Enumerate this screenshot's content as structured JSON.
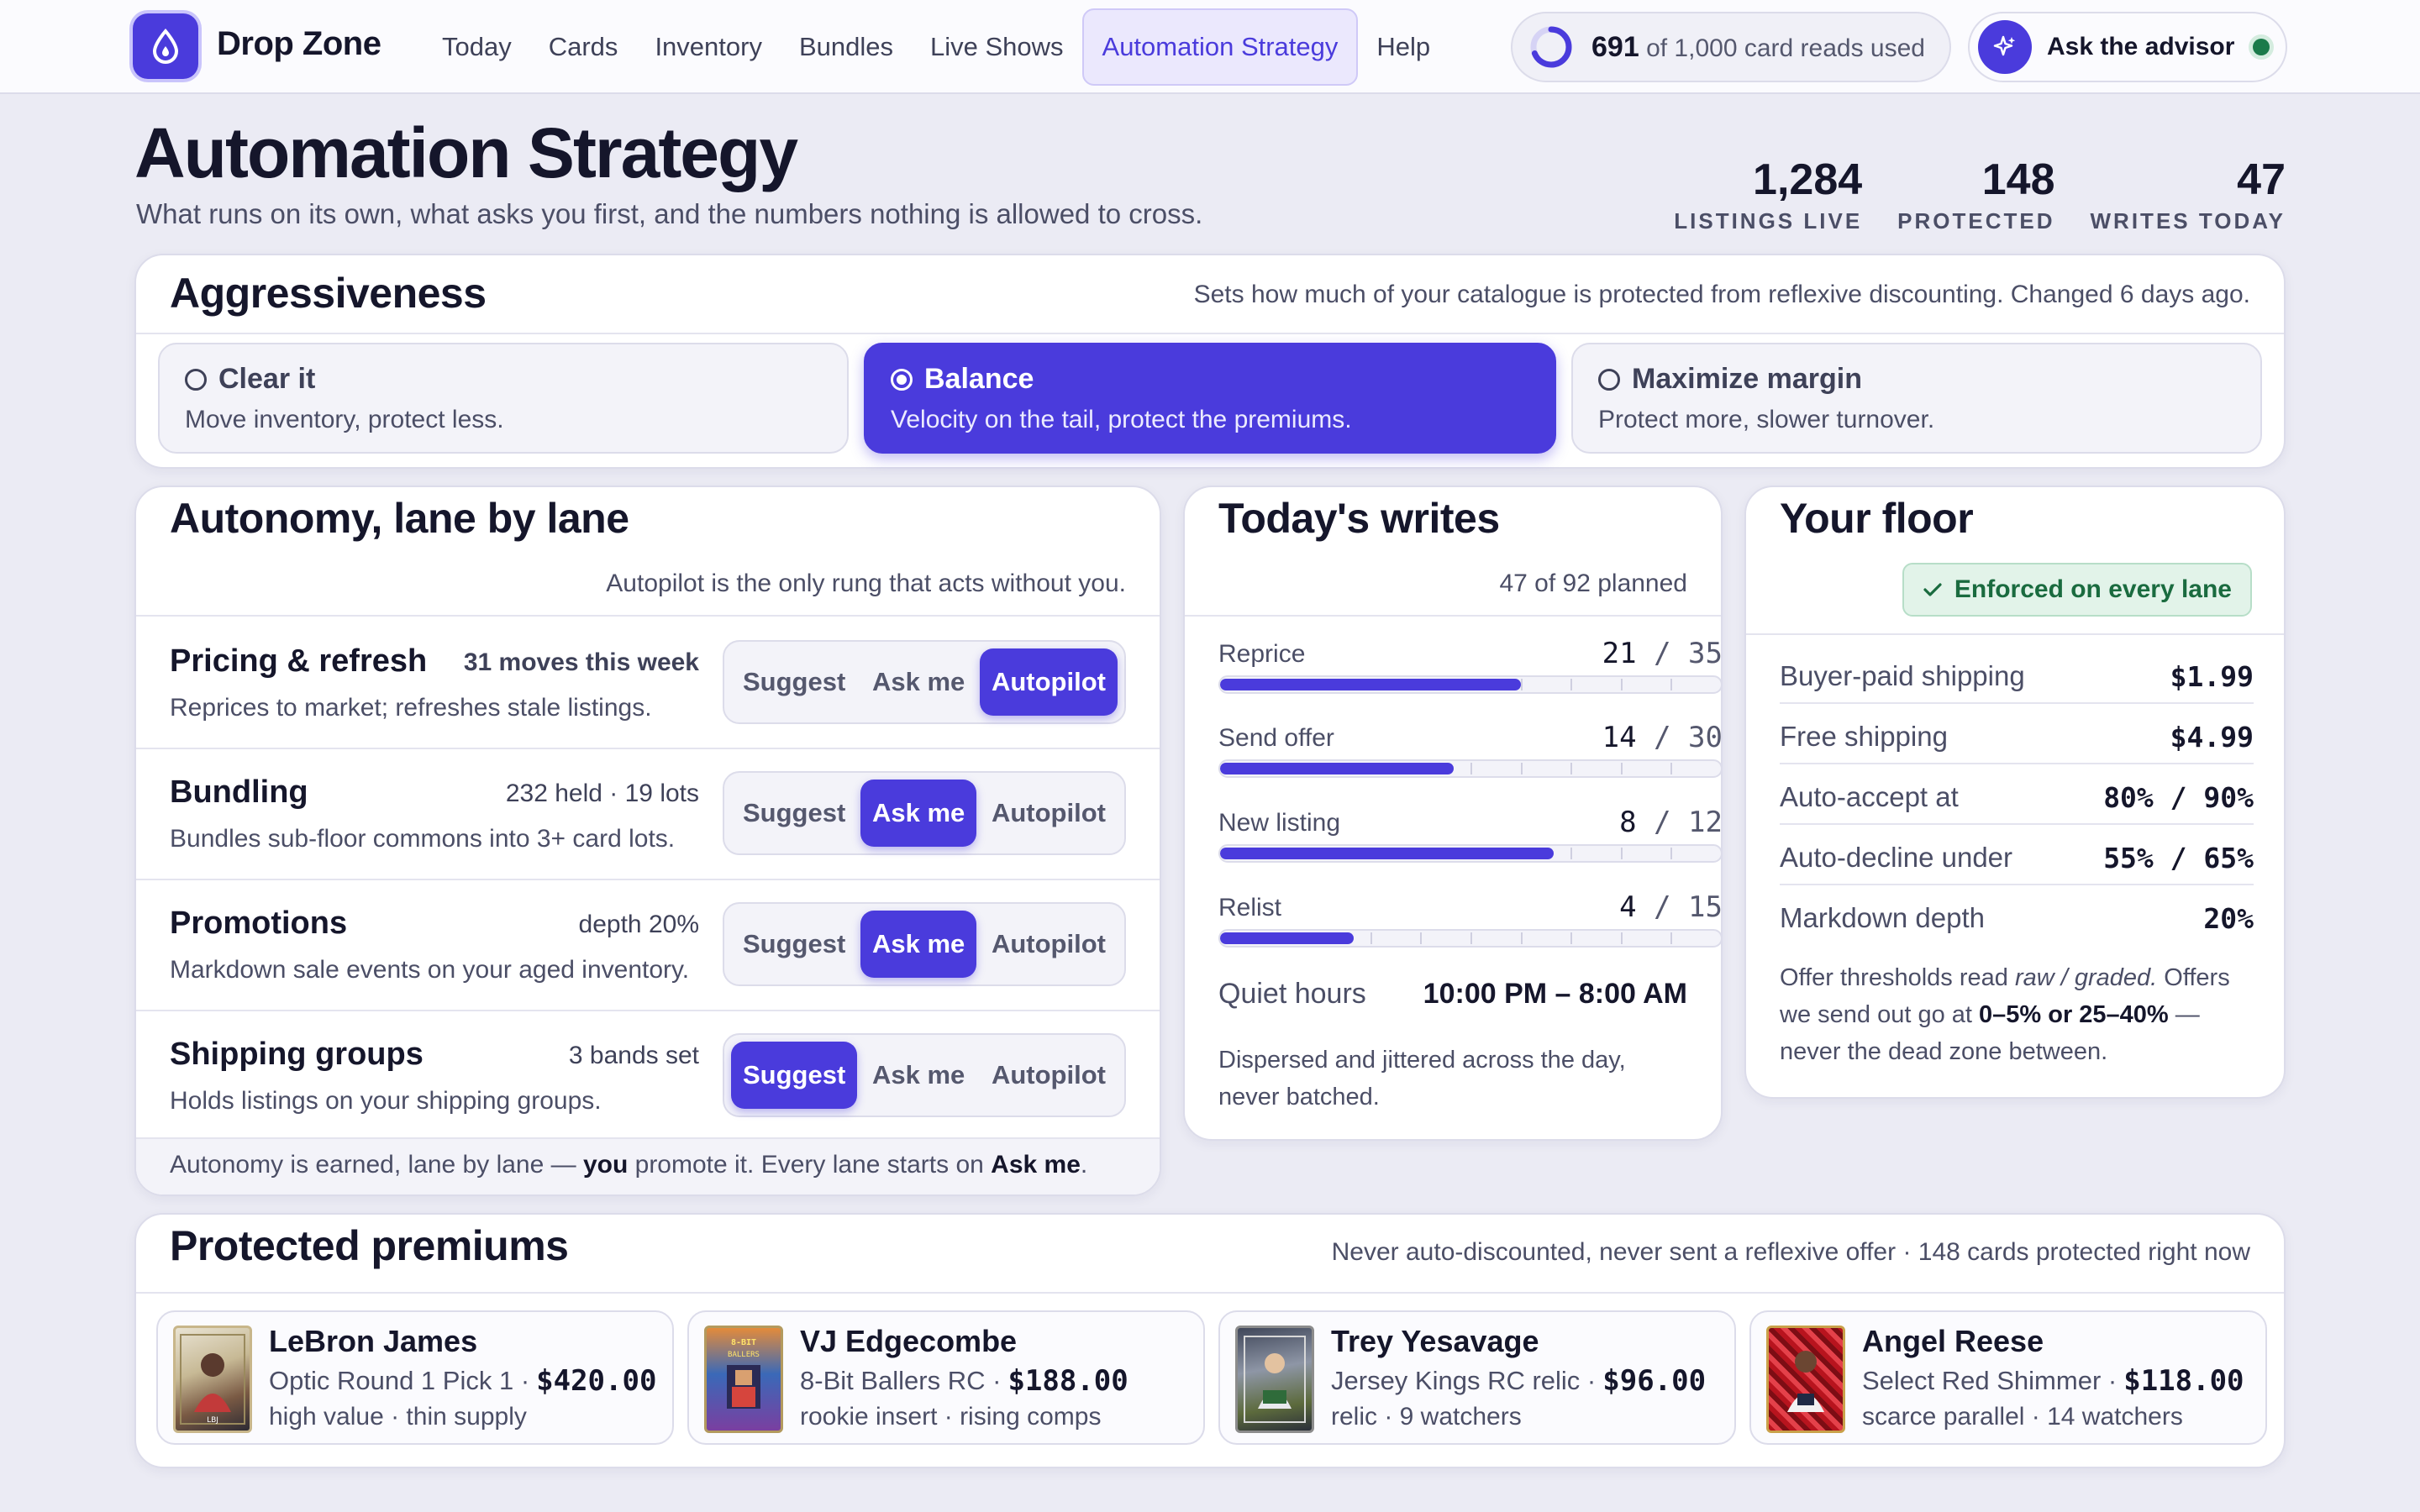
{
  "app": {
    "brand": "Drop Zone",
    "nav": [
      "Today",
      "Cards",
      "Inventory",
      "Bundles",
      "Live Shows",
      "Automation Strategy",
      "Help"
    ],
    "active_nav": "Automation Strategy",
    "usage": {
      "used": "691",
      "rest": "of 1,000 card reads used",
      "fraction": 0.691
    },
    "advisor_label": "Ask the advisor",
    "accent": "#4a3bdc"
  },
  "header": {
    "title": "Automation Strategy",
    "subtitle": "What runs on its own, what asks you first, and the numbers nothing is allowed to cross.",
    "stats": [
      {
        "value": "1,284",
        "label": "LISTINGS LIVE"
      },
      {
        "value": "148",
        "label": "PROTECTED"
      },
      {
        "value": "47",
        "label": "WRITES TODAY"
      }
    ]
  },
  "aggressiveness": {
    "title": "Aggressiveness",
    "note": "Sets how much of your catalogue is protected from reflexive discounting. Changed 6 days ago.",
    "options": [
      {
        "label": "Clear it",
        "desc": "Move inventory, protect less.",
        "selected": false
      },
      {
        "label": "Balance",
        "desc": "Velocity on the tail, protect the premiums.",
        "selected": true
      },
      {
        "label": "Maximize margin",
        "desc": "Protect more, slower turnover.",
        "selected": false
      }
    ]
  },
  "autonomy": {
    "title": "Autonomy, lane by lane",
    "note": "Autopilot is the only rung that acts without you.",
    "modes": [
      "Suggest",
      "Ask me",
      "Autopilot"
    ],
    "lanes": [
      {
        "name": "Pricing & refresh",
        "stat": "31 moves this week",
        "desc": "Reprices to market; refreshes stale listings.",
        "mode": "Autopilot"
      },
      {
        "name": "Bundling",
        "stat": "232 held · 19 lots",
        "desc": "Bundles sub-floor commons into 3+ card lots.",
        "mode": "Ask me"
      },
      {
        "name": "Promotions",
        "stat": "depth 20%",
        "desc": "Markdown sale events on your aged inventory.",
        "mode": "Ask me"
      },
      {
        "name": "Shipping groups",
        "stat": "3 bands set",
        "desc": "Holds listings on your shipping groups.",
        "mode": "Suggest"
      }
    ],
    "footer": {
      "a": "Autonomy is earned, lane by lane — ",
      "b": "you",
      "c": " promote it. Every lane starts on ",
      "d": "Ask me",
      "e": "."
    }
  },
  "writes": {
    "title": "Today's writes",
    "planned": "47 of 92 planned",
    "rows": [
      {
        "label": "Reprice",
        "done": 21,
        "total": 35
      },
      {
        "label": "Send offer",
        "done": 14,
        "total": 30
      },
      {
        "label": "New listing",
        "done": 8,
        "total": 12
      },
      {
        "label": "Relist",
        "done": 4,
        "total": 15
      }
    ],
    "quiet_label": "Quiet hours",
    "quiet_value": "10:00 PM – 8:00 AM",
    "note": "Dispersed and jittered across the day, never batched."
  },
  "floor": {
    "title": "Your floor",
    "badge": "Enforced on every lane",
    "rows": [
      {
        "label": "Buyer-paid shipping",
        "value": "$1.99"
      },
      {
        "label": "Free shipping",
        "value": "$4.99"
      },
      {
        "label": "Auto-accept at",
        "value": "80% / 90%"
      },
      {
        "label": "Auto-decline under",
        "value": "55% / 65%"
      },
      {
        "label": "Markdown depth",
        "value": "20%"
      }
    ],
    "note": {
      "a": "Offer thresholds read ",
      "b": "raw / graded.",
      "c": " Offers we send out go at ",
      "d": "0–5% or 25–40%",
      "e": " — never the dead zone between."
    }
  },
  "premiums": {
    "title": "Protected premiums",
    "note": "Never auto-discounted, never sent a reflexive offer · 148 cards protected right now",
    "cards": [
      {
        "name": "LeBron James",
        "set": "Optic Round 1 Pick 1 ·",
        "price": "$420.00",
        "tags": "high value · thin supply",
        "art": "LBJ"
      },
      {
        "name": "VJ Edgecombe",
        "set": "8-Bit Ballers RC ·",
        "price": "$188.00",
        "tags": "rookie insert · rising comps",
        "art": "8-BIT BALLERS"
      },
      {
        "name": "Trey Yesavage",
        "set": "Jersey Kings RC relic ·",
        "price": "$96.00",
        "tags": "relic · 9 watchers",
        "art": "JK"
      },
      {
        "name": "Angel Reese",
        "set": "Select Red Shimmer ·",
        "price": "$118.00",
        "tags": "scarce parallel · 14 watchers",
        "art": "AR"
      }
    ]
  }
}
